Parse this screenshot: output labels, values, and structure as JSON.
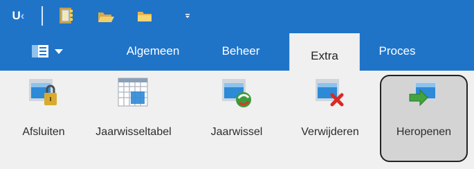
{
  "qat": {
    "logo_text": "U",
    "items": [
      {
        "name": "address-book-icon"
      },
      {
        "name": "open-folder-icon"
      },
      {
        "name": "folder-icon"
      },
      {
        "name": "customize-quick-access-icon"
      }
    ]
  },
  "tabs": [
    {
      "label": "Algemeen",
      "active": false
    },
    {
      "label": "Beheer",
      "active": false
    },
    {
      "label": "Extra",
      "active": true
    },
    {
      "label": "Proces",
      "active": false
    }
  ],
  "ribbon": {
    "buttons": [
      {
        "label": "Afsluiten",
        "icon": "lock-calendar-icon"
      },
      {
        "label": "Jaarwisseltabel",
        "icon": "calendar-grid-icon"
      },
      {
        "label": "Jaarwissel",
        "icon": "calendar-refresh-icon"
      },
      {
        "label": "Verwijderen",
        "icon": "calendar-delete-icon"
      },
      {
        "label": "Heropenen",
        "icon": "calendar-reopen-icon",
        "selected": true
      }
    ]
  },
  "colors": {
    "titlebar": "#1f74c8",
    "ribbon_bg": "#f0f0f0",
    "selected_bg": "#d4d4d4"
  }
}
